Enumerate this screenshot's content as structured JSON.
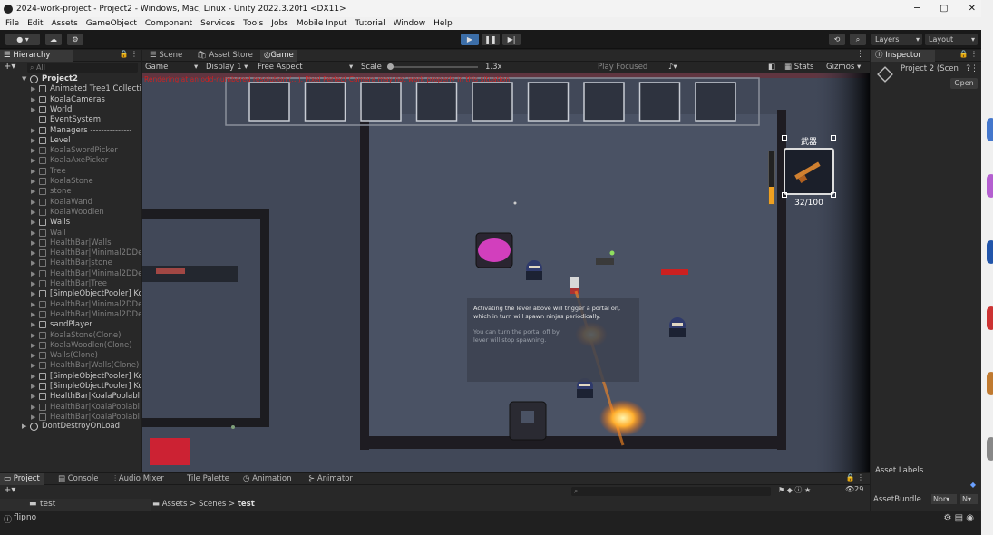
{
  "window": {
    "title": "2024-work-project - Project2 - Windows, Mac, Linux - Unity 2022.3.20f1 <DX11>",
    "controls": [
      "─",
      "▢",
      "✕"
    ]
  },
  "menu": [
    "File",
    "Edit",
    "Assets",
    "GameObject",
    "Component",
    "Services",
    "Tools",
    "Jobs",
    "Mobile Input",
    "Tutorial",
    "Window",
    "Help"
  ],
  "toolbar": {
    "layers_label": "Layers",
    "layout_label": "Layout"
  },
  "hierarchy": {
    "tab_label": "Hierarchy",
    "search_placeholder": "All",
    "root": "Project2",
    "items": [
      {
        "label": "Animated Tree1 Collecti",
        "dim": false,
        "expand": true
      },
      {
        "label": "KoalaCameras",
        "dim": false,
        "expand": true
      },
      {
        "label": "World",
        "dim": false,
        "expand": true
      },
      {
        "label": "EventSystem",
        "dim": false,
        "expand": false
      },
      {
        "label": "Managers ---------------",
        "dim": false,
        "expand": true
      },
      {
        "label": "Level",
        "dim": false,
        "expand": true
      },
      {
        "label": "KoalaSwordPicker",
        "dim": true,
        "expand": true
      },
      {
        "label": "KoalaAxePicker",
        "dim": true,
        "expand": true
      },
      {
        "label": "Tree",
        "dim": true,
        "expand": true
      },
      {
        "label": "KoalaStone",
        "dim": true,
        "expand": true
      },
      {
        "label": "stone",
        "dim": true,
        "expand": true
      },
      {
        "label": "KoalaWand",
        "dim": true,
        "expand": true
      },
      {
        "label": "KoalaWoodlen",
        "dim": true,
        "expand": true
      },
      {
        "label": "Walls",
        "dim": false,
        "expand": true
      },
      {
        "label": "Wall",
        "dim": true,
        "expand": true
      },
      {
        "label": "HealthBar|Walls",
        "dim": true,
        "expand": true
      },
      {
        "label": "HealthBar|Minimal2DDe",
        "dim": true,
        "expand": true
      },
      {
        "label": "HealthBar|stone",
        "dim": true,
        "expand": true
      },
      {
        "label": "HealthBar|Minimal2DDe",
        "dim": true,
        "expand": true
      },
      {
        "label": "HealthBar|Tree",
        "dim": true,
        "expand": true
      },
      {
        "label": "[SimpleObjectPooler] Ko",
        "dim": false,
        "expand": true
      },
      {
        "label": "HealthBar|Minimal2DDe",
        "dim": true,
        "expand": true
      },
      {
        "label": "HealthBar|Minimal2DDe",
        "dim": true,
        "expand": true
      },
      {
        "label": "sandPlayer",
        "dim": false,
        "expand": true
      },
      {
        "label": "KoalaStone(Clone)",
        "dim": true,
        "expand": true
      },
      {
        "label": "KoalaWoodlen(Clone)",
        "dim": true,
        "expand": true
      },
      {
        "label": "Walls(Clone)",
        "dim": true,
        "expand": true
      },
      {
        "label": "HealthBar|Walls(Clone)",
        "dim": true,
        "expand": true
      },
      {
        "label": "[SimpleObjectPooler] Ko",
        "dim": false,
        "expand": true
      },
      {
        "label": "[SimpleObjectPooler] Ko",
        "dim": false,
        "expand": true
      },
      {
        "label": "HealthBar|KoalaPoolabl",
        "dim": false,
        "expand": true
      },
      {
        "label": "HealthBar|KoalaPoolabl",
        "dim": true,
        "expand": true
      },
      {
        "label": "HealthBar|KoalaPoolabl",
        "dim": true,
        "expand": true
      }
    ],
    "dont_destroy": "DontDestroyOnLoad"
  },
  "game_panel": {
    "tabs": [
      "Scene",
      "Asset Store",
      "Game"
    ],
    "bar": {
      "mode": "Game",
      "display": "Display 1",
      "aspect": "Free Aspect",
      "scale_label": "Scale",
      "scale_value": "1.3x",
      "play_focused": "Play Focused",
      "stats": "Stats",
      "gizmos": "Gizmos"
    },
    "warning": "Rendering at an odd-numbered resolution (...). Pixel Perfect Camera may not work properly in this situation.",
    "hud": {
      "weapon_label": "武器",
      "ammo": "32/100",
      "ammo_fraction": 0.32
    },
    "hint_line1": "Activating the lever above will trigger a portal on,",
    "hint_line2": "which in turn will spawn ninjas periodically.",
    "hint_line3": "You can turn the portal off by",
    "hint_line4": "lever will stop spawning."
  },
  "inspector": {
    "tab_label": "Inspector",
    "object": "Project 2 (Scen",
    "open_label": "Open",
    "asset_labels": "Asset Labels",
    "asset_bundle": "AssetBundle",
    "bundle_value": "Nor▾",
    "bundle_variant": "N▾"
  },
  "bottom_panel": {
    "tabs": [
      "Project",
      "Console",
      "Audio Mixer",
      "Tile Palette",
      "Animation",
      "Animator"
    ],
    "folder": "test",
    "breadcrumb": [
      "Assets",
      "Scenes",
      "test"
    ],
    "count": "29"
  },
  "status": {
    "text": "flipno"
  }
}
